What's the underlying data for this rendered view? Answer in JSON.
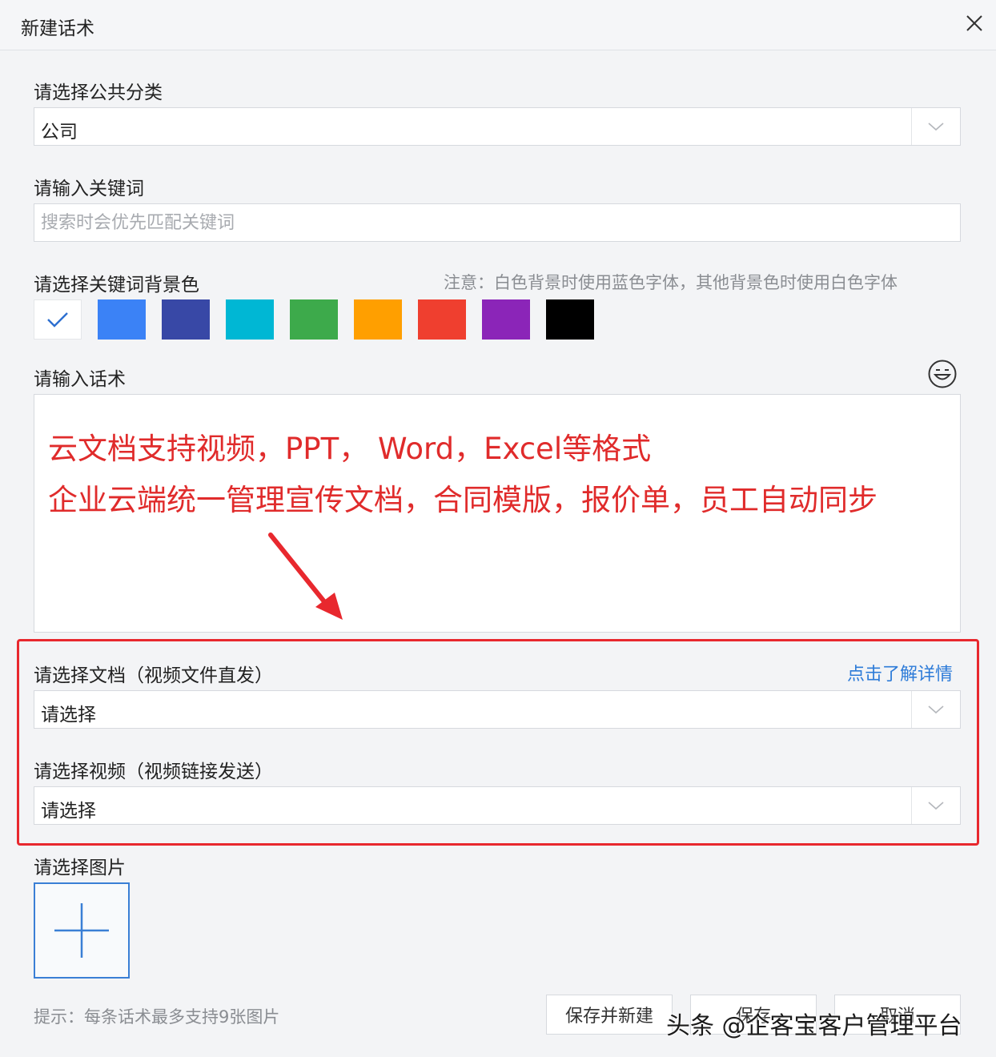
{
  "dialog": {
    "title": "新建话术",
    "close_icon": "close-icon"
  },
  "category": {
    "label": "请选择公共分类",
    "value": "公司"
  },
  "keyword": {
    "label": "请输入关键词",
    "placeholder": "搜索时会优先匹配关键词"
  },
  "bg_color": {
    "label": "请选择关键词背景色",
    "note": "注意：白色背景时使用蓝色字体，其他背景色时使用白色字体",
    "swatches": [
      "#ffffff",
      "#3b82f6",
      "#3848a6",
      "#00b7d4",
      "#3daa4b",
      "#ff9f00",
      "#ef3f2f",
      "#8b25b8",
      "#000000"
    ],
    "selected_index": 0
  },
  "script": {
    "label": "请输入话术",
    "emoji_icon": "emoji-icon",
    "annotation_line1": "云文档支持视频，PPT， Word，Excel等格式",
    "annotation_line2": "企业云端统一管理宣传文档，合同模版，报价单，员工自动同步",
    "accent": "#e02b2b"
  },
  "document": {
    "label": "请选择文档（视频文件直发）",
    "detail_link": "点击了解详情",
    "value": "请选择"
  },
  "video": {
    "label": "请选择视频（视频链接发送）",
    "value": "请选择"
  },
  "image": {
    "label": "请选择图片",
    "hint": "提示：每条话术最多支持9张图片"
  },
  "footer": {
    "save_new": "保存并新建",
    "save": "保存",
    "cancel": "取消"
  },
  "watermark": "头条 @企客宝客户管理平台"
}
